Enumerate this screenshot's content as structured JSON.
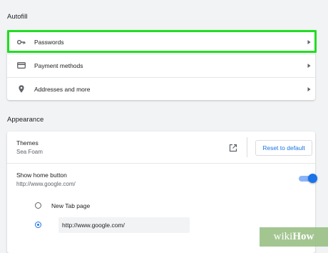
{
  "autofill": {
    "title": "Autofill",
    "items": [
      {
        "label": "Passwords",
        "icon": "key-icon"
      },
      {
        "label": "Payment methods",
        "icon": "credit-card-icon"
      },
      {
        "label": "Addresses and more",
        "icon": "location-pin-icon"
      }
    ]
  },
  "appearance": {
    "title": "Appearance",
    "themes": {
      "label": "Themes",
      "value": "Sea Foam",
      "reset_label": "Reset to default"
    },
    "home_button": {
      "label": "Show home button",
      "url": "http://www.google.com/",
      "enabled": true
    },
    "home_options": [
      {
        "label": "New Tab page",
        "selected": false
      },
      {
        "label": "http://www.google.com/",
        "selected": true
      }
    ]
  },
  "watermark": {
    "text_wiki": "wiki",
    "text_how": "How"
  },
  "colors": {
    "highlight": "#22dd22",
    "accent": "#1a73e8"
  }
}
